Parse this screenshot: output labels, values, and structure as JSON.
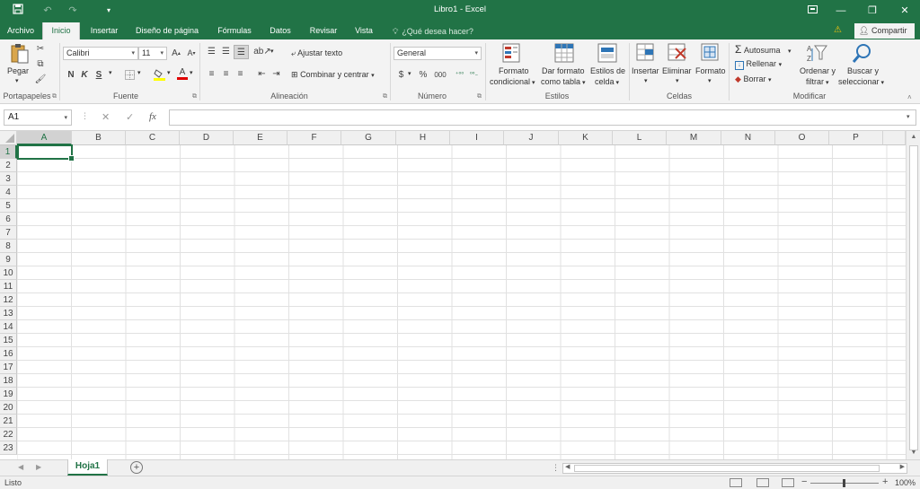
{
  "titlebar": {
    "title": "Libro1 - Excel",
    "quick_access": [
      "save-icon",
      "undo-icon",
      "redo-icon",
      "customize-icon"
    ],
    "window_buttons": [
      "ribbon-display-icon",
      "minimize-icon",
      "restore-icon",
      "close-icon"
    ]
  },
  "tabs": [
    {
      "label": "Archivo"
    },
    {
      "label": "Inicio",
      "active": true
    },
    {
      "label": "Insertar"
    },
    {
      "label": "Diseño de página"
    },
    {
      "label": "Fórmulas"
    },
    {
      "label": "Datos"
    },
    {
      "label": "Revisar"
    },
    {
      "label": "Vista"
    }
  ],
  "tell_me": "¿Qué desea hacer?",
  "share": "Compartir",
  "ribbon": {
    "clipboard": {
      "paste": "Pegar",
      "label": "Portapapeles"
    },
    "font": {
      "name": "Calibri",
      "size": "11",
      "bold": "N",
      "italic": "K",
      "underline": "S",
      "label": "Fuente"
    },
    "alignment": {
      "wrap": "Ajustar texto",
      "merge": "Combinar y centrar",
      "label": "Alineación"
    },
    "number": {
      "format": "General",
      "currency": "$",
      "percent": "%",
      "thousands": "000",
      "label": "Número"
    },
    "styles": {
      "conditional_1": "Formato",
      "conditional_2": "condicional",
      "table_1": "Dar formato",
      "table_2": "como tabla",
      "cell_1": "Estilos de",
      "cell_2": "celda",
      "label": "Estilos"
    },
    "cells": {
      "insert": "Insertar",
      "delete": "Eliminar",
      "format": "Formato",
      "label": "Celdas"
    },
    "editing": {
      "autosum": "Autosuma",
      "fill": "Rellenar",
      "clear": "Borrar",
      "sort_1": "Ordenar y",
      "sort_2": "filtrar",
      "find_1": "Buscar y",
      "find_2": "seleccionar",
      "label": "Modificar"
    }
  },
  "formula_bar": {
    "name_box": "A1",
    "cancel": "✕",
    "enter": "✓",
    "fx": "fx",
    "value": ""
  },
  "grid": {
    "columns": [
      "A",
      "B",
      "C",
      "D",
      "E",
      "F",
      "G",
      "H",
      "I",
      "J",
      "K",
      "L",
      "M",
      "N",
      "O",
      "P"
    ],
    "rows": [
      "1",
      "2",
      "3",
      "4",
      "5",
      "6",
      "7",
      "8",
      "9",
      "10",
      "11",
      "12",
      "13",
      "14",
      "15",
      "16",
      "17",
      "18",
      "19",
      "20",
      "21",
      "22",
      "23"
    ],
    "active_cell": "A1"
  },
  "sheets": [
    {
      "name": "Hoja1",
      "active": true
    }
  ],
  "status": {
    "text": "Listo",
    "zoom": "100%",
    "minus": "−",
    "plus": "+"
  },
  "colors": {
    "accent": "#217346"
  }
}
